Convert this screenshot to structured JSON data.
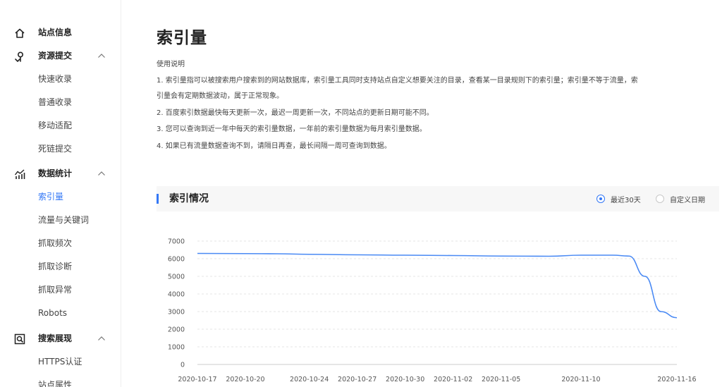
{
  "sidebar": {
    "groups": [
      {
        "label": "站点信息",
        "icon": "home-icon",
        "items": []
      },
      {
        "label": "资源提交",
        "icon": "upload-pin-icon",
        "items": [
          "快速收录",
          "普通收录",
          "移动适配",
          "死链提交"
        ]
      },
      {
        "label": "数据统计",
        "icon": "stats-chart-icon",
        "items": [
          "索引量",
          "流量与关键词",
          "抓取频次",
          "抓取诊断",
          "抓取异常",
          "Robots"
        ]
      },
      {
        "label": "搜索展现",
        "icon": "search-display-icon",
        "items": [
          "HTTPS认证",
          "站点属性"
        ]
      }
    ],
    "active_item": "索引量"
  },
  "main": {
    "title": "索引量",
    "usage_title": "使用说明",
    "usage_lines": [
      "1. 索引量指可以被搜索用户搜索到的网站数据库，索引量工具同时支持站点自定义想要关注的目录，查看某一目录规则下的索引量；索引量不等于流量，索",
      "引量会有定期数据波动，属于正常现象。",
      "2. 百度索引数据最快每天更新一次，最迟一周更新一次，不同站点的更新日期可能不同。",
      "3. 您可以查询到近一年中每天的索引量数据，一年前的索引量数据为每月索引量数据。",
      "4. 如果已有流量数据查询不到，请隔日再查，最长间隔一周可查询到数据。"
    ],
    "section_title": "索引情况",
    "range_options": [
      {
        "label": "最近30天",
        "checked": true
      },
      {
        "label": "自定义日期",
        "checked": false
      }
    ]
  },
  "colors": {
    "accent": "#3478f6",
    "line": "#4a8af4",
    "grid": "#e6e6e6"
  },
  "chart_data": {
    "type": "line",
    "title": "",
    "xlabel": "",
    "ylabel": "",
    "ylim": [
      0,
      7000
    ],
    "yticks": [
      0,
      1000,
      2000,
      3000,
      4000,
      5000,
      6000,
      7000
    ],
    "x_tick_labels": [
      "2020-10-17",
      "2020-10-20",
      "2020-10-24",
      "2020-10-27",
      "2020-10-30",
      "2020-11-02",
      "2020-11-05",
      "2020-11-10",
      "2020-11-16"
    ],
    "grid": true,
    "series": [
      {
        "x": [
          "2020-10-17",
          "2020-10-20",
          "2020-10-22",
          "2020-10-24",
          "2020-10-27",
          "2020-10-30",
          "2020-11-02",
          "2020-11-05",
          "2020-11-08",
          "2020-11-10",
          "2020-11-12",
          "2020-11-13",
          "2020-11-14",
          "2020-11-15",
          "2020-11-16"
        ],
        "values": [
          6300,
          6290,
          6280,
          6250,
          6220,
          6200,
          6180,
          6150,
          6140,
          6200,
          6200,
          6150,
          5000,
          3000,
          2650
        ]
      }
    ]
  }
}
